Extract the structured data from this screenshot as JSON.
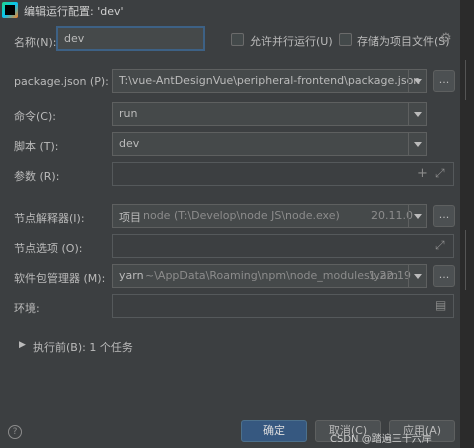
{
  "window": {
    "title": "编辑运行配置: 'dev'"
  },
  "name_row": {
    "label": "名称(N):",
    "value": "dev",
    "allow_parallel_label": "允许并行运行(U)",
    "store_as_file_label": "存储为项目文件(S)"
  },
  "package_json": {
    "label": "package.json (P):",
    "value": "T:\\vue-AntDesignVue\\peripheral-frontend\\package.json",
    "browse": "..."
  },
  "command": {
    "label": "命令(C):",
    "value": "run"
  },
  "scripts": {
    "label": "脚本 (T):",
    "value": "dev"
  },
  "arguments": {
    "label": "参数 (R):",
    "value": ""
  },
  "node_interpreter": {
    "label": "节点解释器(I):",
    "prefix": "项目",
    "value": "node (T:\\Develop\\node JS\\node.exe)",
    "version": "20.11.0",
    "browse": "..."
  },
  "node_options": {
    "label": "节点选项 (O):",
    "value": ""
  },
  "package_manager": {
    "label": "软件包管理器 (M):",
    "name": "yarn",
    "path": "~\\AppData\\Roaming\\npm\\node_modules\\yarn",
    "version": "1.22.19",
    "browse": "..."
  },
  "environment": {
    "label": "环境:",
    "value": ""
  },
  "before_launch": {
    "label": "执行前(B): 1 个任务"
  },
  "buttons": {
    "ok": "确定",
    "cancel": "取消(C)",
    "apply": "应用(A)"
  },
  "watermark": "CSDN @踏遍三十六岸",
  "help": "?"
}
